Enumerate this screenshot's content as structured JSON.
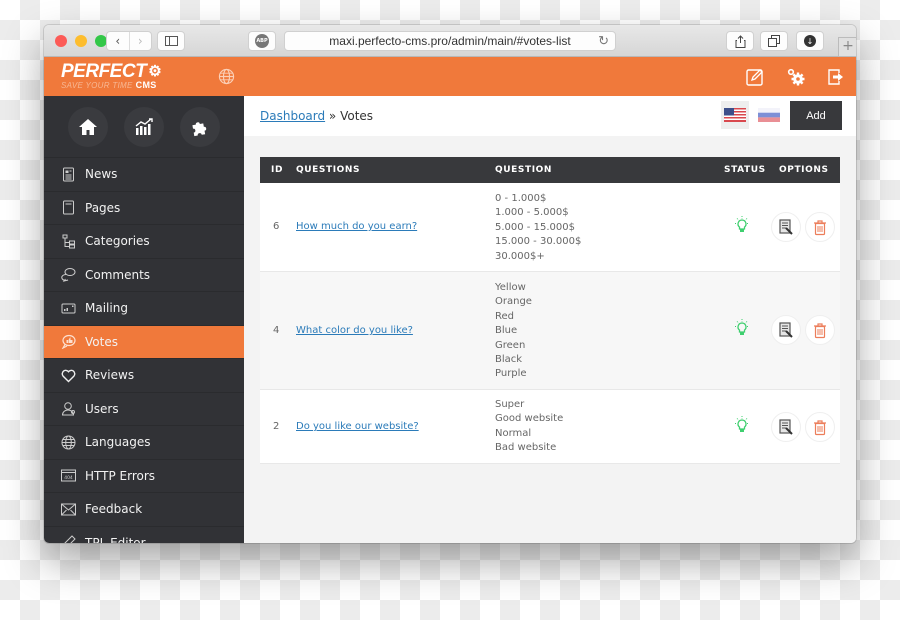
{
  "browser": {
    "url": "maxi.perfecto-cms.pro/admin/main/#votes-list",
    "back_label": "‹",
    "forward_label": "›",
    "adblock_label": "ABP",
    "new_tab_label": "+"
  },
  "app": {
    "logo_main": "PERFECT",
    "logo_tagline": "SAVE YOUR TIME",
    "logo_suffix": "CMS",
    "accent_color": "#f0793b",
    "header_icons": [
      "globe-icon",
      "edit-icon",
      "settings-icon",
      "logout-icon"
    ]
  },
  "sidebar": {
    "quick_buttons": [
      "home-icon",
      "stats-icon",
      "plugins-icon"
    ],
    "items": [
      {
        "label": "News",
        "icon": "news-icon"
      },
      {
        "label": "Pages",
        "icon": "pages-icon"
      },
      {
        "label": "Categories",
        "icon": "categories-icon"
      },
      {
        "label": "Comments",
        "icon": "comments-icon"
      },
      {
        "label": "Mailing",
        "icon": "mailing-icon"
      },
      {
        "label": "Votes",
        "icon": "votes-icon",
        "active": true
      },
      {
        "label": "Reviews",
        "icon": "heart-icon"
      },
      {
        "label": "Users",
        "icon": "user-icon"
      },
      {
        "label": "Languages",
        "icon": "globe-icon"
      },
      {
        "label": "HTTP Errors",
        "icon": "http-404-icon"
      },
      {
        "label": "Feedback",
        "icon": "envelope-icon"
      },
      {
        "label": "TPL Editor",
        "icon": "pencil-icon"
      }
    ]
  },
  "content": {
    "breadcrumb": {
      "link": "Dashboard",
      "separator": " » ",
      "current": "Votes"
    },
    "languages": [
      "English (US flag)",
      "Russian flag"
    ],
    "add_label": "Add",
    "table": {
      "headers": {
        "id": "ID",
        "questions": "QUESTIONS",
        "question": "QUESTION",
        "status": "STATUS",
        "options": "OPTIONS"
      },
      "rows": [
        {
          "id": "6",
          "question": "How much do you earn?",
          "answers": [
            "0 - 1.000$",
            "1.000 - 5.000$",
            "5.000 - 15.000$",
            "15.000 - 30.000$",
            "30.000$+"
          ],
          "status": "active"
        },
        {
          "id": "4",
          "question": "What color do you like?",
          "answers": [
            "Yellow",
            "Orange",
            "Red",
            "Blue",
            "Green",
            "Black",
            "Purple"
          ],
          "status": "active"
        },
        {
          "id": "2",
          "question": "Do you like our website?",
          "answers": [
            "Super",
            "Good website",
            "Normal",
            "Bad website"
          ],
          "status": "active"
        }
      ]
    }
  }
}
